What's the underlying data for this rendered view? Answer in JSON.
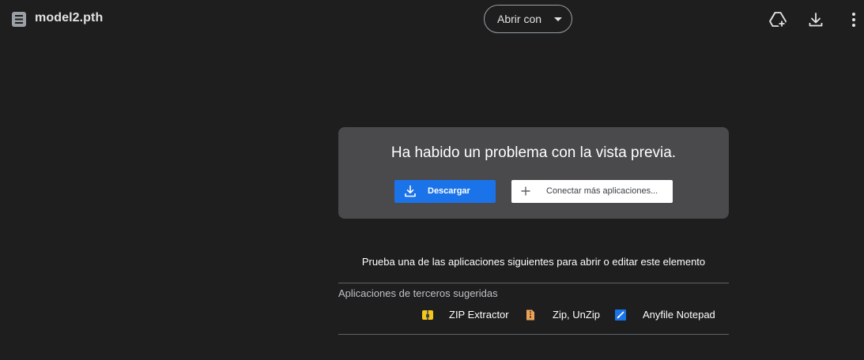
{
  "file": {
    "name": "model2.pth",
    "icon": "archive-file-icon"
  },
  "toolbar": {
    "open_with_label": "Abrir con",
    "add_to_drive_icon": "add-to-drive-icon",
    "download_icon": "download-icon",
    "more_icon": "more-vert-icon"
  },
  "preview": {
    "message": "Ha habido un problema con la vista previa.",
    "download_label": "Descargar",
    "connect_label": "Conectar más aplicaciones..."
  },
  "suggestions": {
    "prompt": "Prueba una de las aplicaciones siguientes para abrir o editar este elemento",
    "heading": "Aplicaciones de terceros sugeridas",
    "apps": [
      {
        "name": "ZIP Extractor",
        "icon": "zip-extractor-icon"
      },
      {
        "name": "Zip, UnZip",
        "icon": "zip-unzip-icon"
      },
      {
        "name": "Anyfile Notepad",
        "icon": "anyfile-notepad-icon"
      }
    ]
  },
  "colors": {
    "background": "#1e1e1e",
    "panel": "#4a494b",
    "primary": "#1a73e8"
  }
}
